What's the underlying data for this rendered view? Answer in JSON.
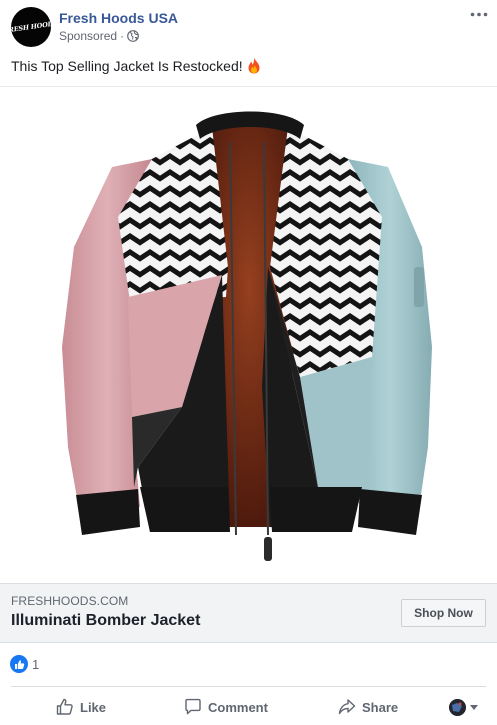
{
  "post": {
    "page_name": "Fresh Hoods USA",
    "avatar_text": "FRESH HOODS",
    "sponsored_label": "Sponsored",
    "separator": "·",
    "caption": "This Top Selling Jacket Is Restocked!",
    "caption_icon": "fire-icon"
  },
  "image": {
    "subject": "bomber jacket",
    "colors": {
      "pink": "#d9a5ab",
      "blue": "#9fc3c8",
      "black": "#1a1a1a",
      "lining": "#7a2f1c",
      "chevron_white": "#f4f4f4"
    }
  },
  "link": {
    "domain": "FRESHHOODS.COM",
    "title": "Illuminati Bomber Jacket",
    "cta_label": "Shop Now"
  },
  "reactions": {
    "icon": "like-icon",
    "count": "1"
  },
  "actions": {
    "like_label": "Like",
    "comment_label": "Comment",
    "share_label": "Share"
  },
  "colors": {
    "page_link": "#385898",
    "meta_text": "#616770",
    "like_blue": "#1877f2",
    "link_bg": "#f2f3f5"
  }
}
